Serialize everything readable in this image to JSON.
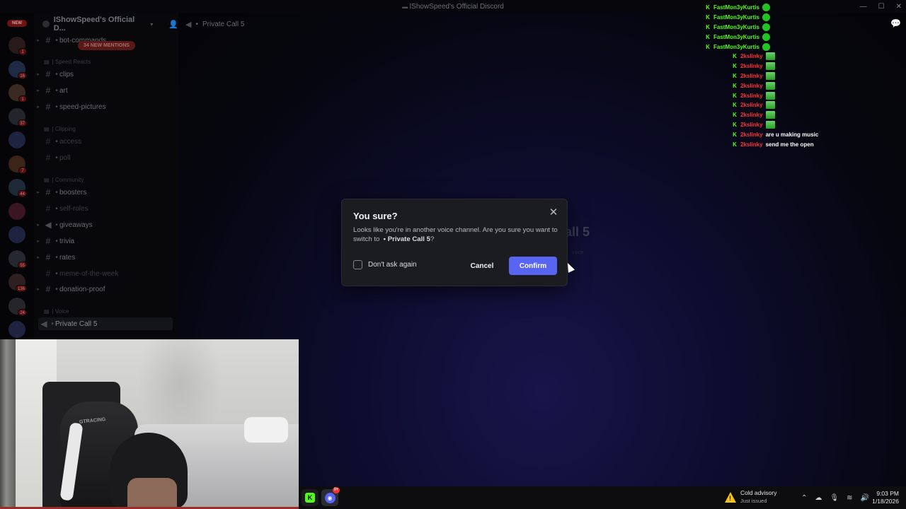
{
  "window": {
    "title": "IShowSpeed's Official Discord",
    "controls": [
      "—",
      "☐",
      "✕"
    ]
  },
  "rail": {
    "new_label": "NEW",
    "servers": [
      {
        "color": "#2a1b1b",
        "badge": "1"
      },
      {
        "color": "#1f2a44",
        "badge": "16"
      },
      {
        "color": "#3a2a22",
        "badge": "1"
      },
      {
        "color": "#22252c",
        "badge": "37"
      },
      {
        "color": "#1e2440",
        "badge": ""
      },
      {
        "color": "#3b2418",
        "badge": "7"
      },
      {
        "color": "#1e2a3a",
        "badge": "44"
      },
      {
        "color": "#3a1522",
        "badge": ""
      },
      {
        "color": "#1e2440",
        "badge": ""
      },
      {
        "color": "#25282e",
        "badge": "55"
      },
      {
        "color": "#2e2020",
        "badge": "136"
      },
      {
        "color": "#26262a",
        "badge": "24"
      },
      {
        "color": "#1e2440",
        "badge": ""
      }
    ]
  },
  "sidebar": {
    "guild_name": "IShowSpeed's Official D...",
    "mentions_pill": "34 NEW MENTIONS",
    "categories": {
      "speed_reacts": "| Speed Reacts",
      "clipping": "| Clipping",
      "community": "| Community",
      "voice": "| Voice"
    },
    "channels": {
      "bot_commands": "bot-commands",
      "clips": "clips",
      "art": "art",
      "speed_pictures": "speed-pictures",
      "access": "access",
      "poll": "poll",
      "boosters": "boosters",
      "self_roles": "self-roles",
      "giveaways": "giveaways",
      "trivia": "trivia",
      "rates": "rates",
      "meme_of_the_week": "meme-of-the-week",
      "donation_proof": "donation-proof",
      "private_call_5": "Private Call 5"
    }
  },
  "main": {
    "header_channel": "Private Call 5",
    "bg_title": "all 5",
    "bg_sub": "voice"
  },
  "chat": {
    "rows": [
      {
        "user": "FastMon3yKurtis",
        "color": "green",
        "message": "",
        "emote": "round",
        "indent": false
      },
      {
        "user": "FastMon3yKurtis",
        "color": "green",
        "message": "",
        "emote": "round",
        "indent": false
      },
      {
        "user": "FastMon3yKurtis",
        "color": "green",
        "message": "",
        "emote": "round",
        "indent": false
      },
      {
        "user": "FastMon3yKurtis",
        "color": "green",
        "message": "",
        "emote": "round",
        "indent": false
      },
      {
        "user": "FastMon3yKurtis",
        "color": "green",
        "message": "",
        "emote": "round",
        "indent": false
      },
      {
        "user": "2kslinky",
        "color": "red",
        "message": "",
        "emote": "build",
        "indent": true
      },
      {
        "user": "2kslinky",
        "color": "red",
        "message": "",
        "emote": "build",
        "indent": true
      },
      {
        "user": "2kslinky",
        "color": "red",
        "message": "",
        "emote": "build",
        "indent": true
      },
      {
        "user": "2kslinky",
        "color": "red",
        "message": "",
        "emote": "build",
        "indent": true
      },
      {
        "user": "2kslinky",
        "color": "red",
        "message": "",
        "emote": "build",
        "indent": true
      },
      {
        "user": "2kslinky",
        "color": "red",
        "message": "",
        "emote": "build",
        "indent": true
      },
      {
        "user": "2kslinky",
        "color": "red",
        "message": "",
        "emote": "build",
        "indent": true
      },
      {
        "user": "2kslinky",
        "color": "red",
        "message": "",
        "emote": "build",
        "indent": true
      },
      {
        "user": "2kslinky",
        "color": "red",
        "message": "are u making music",
        "emote": "",
        "indent": true
      },
      {
        "user": "2kslinky",
        "color": "red",
        "message": "send me the open",
        "emote": "",
        "indent": true
      }
    ]
  },
  "modal": {
    "title": "You sure?",
    "body_prefix": "Looks like you're in another voice channel. Are you sure you want to switch to",
    "target_channel": "• Private Call 5",
    "body_suffix": "?",
    "checkbox_label": "Don't ask again",
    "checkbox_checked": false,
    "cancel_label": "Cancel",
    "confirm_label": "Confirm",
    "confirm_color": "#5865f2"
  },
  "webcam": {
    "chair_brand": "GTRACING"
  },
  "taskbar": {
    "discord_badge": "9+",
    "weather_title": "Cold advisory",
    "weather_sub": "Just issued",
    "time": "9:03 PM",
    "date": "1/18/2026"
  }
}
